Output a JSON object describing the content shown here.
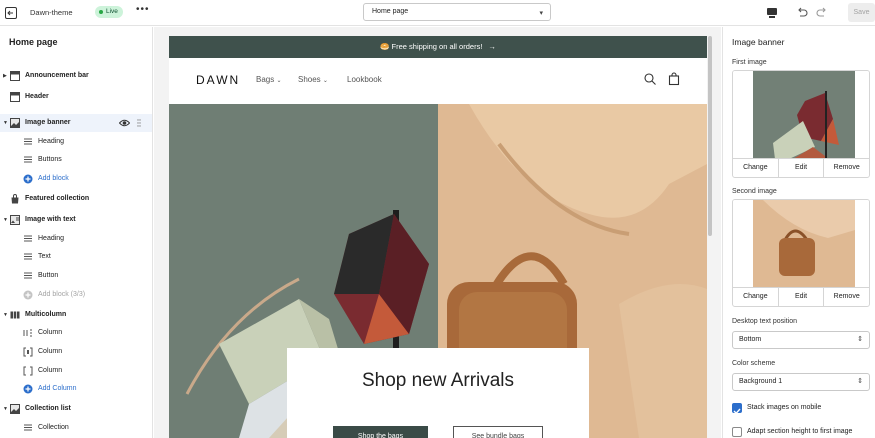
{
  "topbar": {
    "theme_name": "Dawn-theme",
    "status_badge": "Live",
    "more_label": "•••",
    "page_select": "Home page",
    "save_label": "Save"
  },
  "left_panel": {
    "title": "Home page",
    "items": [
      {
        "label": "Announcement bar",
        "icon": "layout-icon"
      },
      {
        "label": "Header",
        "icon": "header-icon"
      },
      {
        "label": "Image banner",
        "icon": "image-icon"
      },
      {
        "label": "Heading",
        "icon": "text-lines-icon"
      },
      {
        "label": "Buttons",
        "icon": "text-lines-icon"
      },
      {
        "label": "Add block",
        "icon": "add-circle-icon"
      },
      {
        "label": "Featured collection",
        "icon": "bag-icon"
      },
      {
        "label": "Image with text",
        "icon": "image-text-icon"
      },
      {
        "label": "Heading",
        "icon": "text-lines-icon"
      },
      {
        "label": "Text",
        "icon": "text-lines-icon"
      },
      {
        "label": "Button",
        "icon": "text-lines-icon"
      },
      {
        "label": "Add block (3/3)",
        "icon": "add-circle-icon"
      },
      {
        "label": "Multicolumn",
        "icon": "columns-icon"
      },
      {
        "label": "Column",
        "icon": "column-icon"
      },
      {
        "label": "Column",
        "icon": "column-icon"
      },
      {
        "label": "Column",
        "icon": "column-icon"
      },
      {
        "label": "Add Column",
        "icon": "add-circle-icon"
      },
      {
        "label": "Collection list",
        "icon": "image-icon"
      },
      {
        "label": "Collection",
        "icon": "text-lines-icon"
      }
    ]
  },
  "store": {
    "announcement": "🥯 Free shipping on all orders!",
    "logo": "DAWN",
    "nav": [
      "Bags",
      "Shoes",
      "Lookbook"
    ],
    "headline": "Shop new Arrivals",
    "primary_button": "Shop the bags",
    "secondary_button": "See bundle bags"
  },
  "right_panel": {
    "title": "Image banner",
    "first_image_label": "First image",
    "second_image_label": "Second image",
    "actions": [
      "Change",
      "Edit",
      "Remove"
    ],
    "desktop_position_label": "Desktop text position",
    "desktop_position_value": "Bottom",
    "color_scheme_label": "Color scheme",
    "color_scheme_value": "Background 1",
    "stack_label": "Stack images on mobile",
    "stack_checked": true,
    "adapt_label": "Adapt section height to first image",
    "adapt_checked": false
  },
  "colors": {
    "accent": "#2c6ecb",
    "announcement_bg": "#3f514c",
    "live_badge": "#cdf3da"
  }
}
